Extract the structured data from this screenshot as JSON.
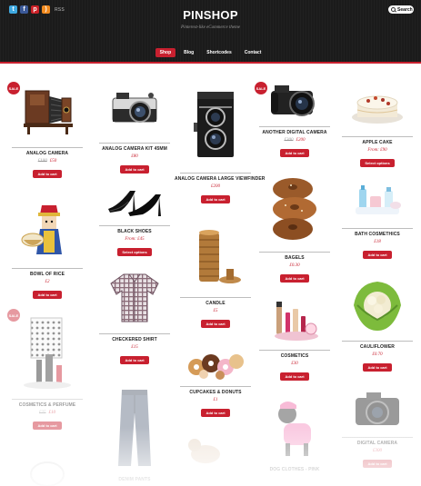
{
  "header": {
    "logo": "PINSHOP",
    "tagline": "Pinterest-like eCommerce theme",
    "rss_label": "RSS",
    "search_label": "Search",
    "social_icons": [
      "twitter-icon",
      "facebook-icon",
      "pinterest-icon",
      "rss-icon"
    ],
    "accent_color": "#c8202f"
  },
  "nav": [
    "Shop",
    "Blog",
    "Shortcodes",
    "Contact"
  ],
  "sale_badge": "SALE",
  "products": [
    {
      "title": "ANALOG CAMERA",
      "old_price": "£100",
      "price": "£50",
      "button": "Add to cart"
    },
    {
      "title": "ANALOG CAMERA KIT 45MM",
      "price": "£80",
      "button": "Add to cart"
    },
    {
      "title": "ANALOG CAMERA LARGE VIEWFINDER",
      "price": "£200",
      "button": "Add to cart"
    },
    {
      "title": "ANOTHER DIGITAL CAMERA",
      "old_price": "£300",
      "price": "£200",
      "button": "Add to cart"
    },
    {
      "title": "APPLE CAKE",
      "price": "From: £90",
      "button": "Select options"
    },
    {
      "title": "BLACK SHOES",
      "price": "From: £45",
      "button": "Select options"
    },
    {
      "title": "BATH COSMETHICS",
      "price": "£18",
      "button": "Add to cart"
    },
    {
      "title": "BOWL OF RICE",
      "price": "£2",
      "button": "Add to cart"
    },
    {
      "title": "CANDLE",
      "price": "£5",
      "button": "Add to cart"
    },
    {
      "title": "BAGELS",
      "price": "£0.30",
      "button": "Add to cart"
    },
    {
      "title": "CHECKERED SHIRT",
      "price": "£15",
      "button": "Add to cart"
    },
    {
      "title": "CAULIFLOWER",
      "price": "£0.70",
      "button": "Add to cart"
    },
    {
      "title": "COSMETICS",
      "price": "£30",
      "button": "Add to cart"
    },
    {
      "title": "CUPCAKES & DONUTS",
      "price": "£1",
      "button": "Add to cart"
    },
    {
      "title": "COSMETICS & PERFUME",
      "old_price": "£25",
      "price": "£10",
      "button": "Add to cart"
    },
    {
      "title": "DIGITAL CAMERA",
      "price": "£300",
      "button": "Add to cart"
    },
    {
      "title": "DENIM PANTS"
    },
    {
      "title": "DOG CLOTHES - PINK"
    }
  ]
}
